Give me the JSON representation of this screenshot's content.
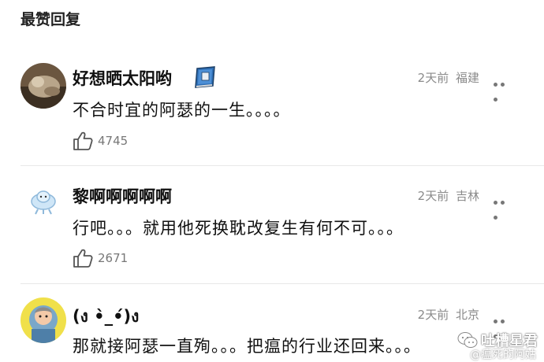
{
  "section_title": "最赞回复",
  "comments": [
    {
      "username": "好想晒太阳哟",
      "badge_icon": "book-badge-icon",
      "time": "2天前",
      "location": "福建",
      "text": "不合时宜的阿瑟的一生。。。。",
      "likes": "4745"
    },
    {
      "username": "黎啊啊啊啊啊",
      "time": "2天前",
      "location": "吉林",
      "text": "行吧。。。就用他死换耽改复生有何不可。。。",
      "likes": "2671"
    },
    {
      "username": "(ง •̀_•́)ง",
      "time": "2天前",
      "location": "北京",
      "text": "那就接阿瑟一直殉。。。把瘟的行业还回来。。。"
    }
  ],
  "watermark": {
    "name": "吐槽星君",
    "sub": "@瘟死的阿姑"
  },
  "colors": {
    "meta_gray": "#8a8a8a",
    "divider": "#e8e8e8",
    "text": "#111111"
  }
}
